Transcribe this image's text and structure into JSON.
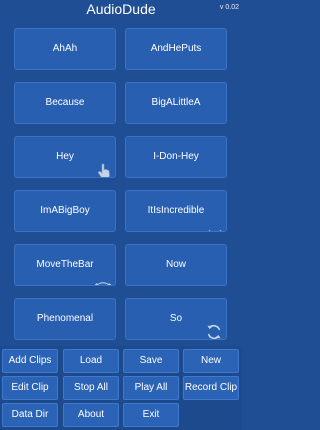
{
  "app": {
    "title": "AudioDude",
    "version": "v 0.02"
  },
  "clips": [
    {
      "label": "AhAh"
    },
    {
      "label": "AndHePuts"
    },
    {
      "label": "Because"
    },
    {
      "label": "BigALittleA"
    },
    {
      "label": "Hey",
      "icon": "hand-pointer-icon"
    },
    {
      "label": "I-Don-Hey"
    },
    {
      "label": "ImABigBoy"
    },
    {
      "label": "ItIsIncredible",
      "icon": "arrows-inward-icon"
    },
    {
      "label": "MoveTheBar",
      "icon": "arrows-loop-icon"
    },
    {
      "label": "Now"
    },
    {
      "label": "Phenomenal"
    },
    {
      "label": "So",
      "icon": "refresh-icon"
    }
  ],
  "toolbar": {
    "row1": [
      "Add Clips",
      "Load",
      "Save",
      "New"
    ],
    "row2": [
      "Edit Clip",
      "Stop All",
      "Play All",
      "Record Clip"
    ],
    "row3": [
      "Data Dir",
      "About",
      "Exit"
    ]
  },
  "colors": {
    "background": "#1f4e94",
    "clip_button": "#285fb1",
    "toolbar_button": "#2b63b7",
    "text": "#ffffff"
  }
}
